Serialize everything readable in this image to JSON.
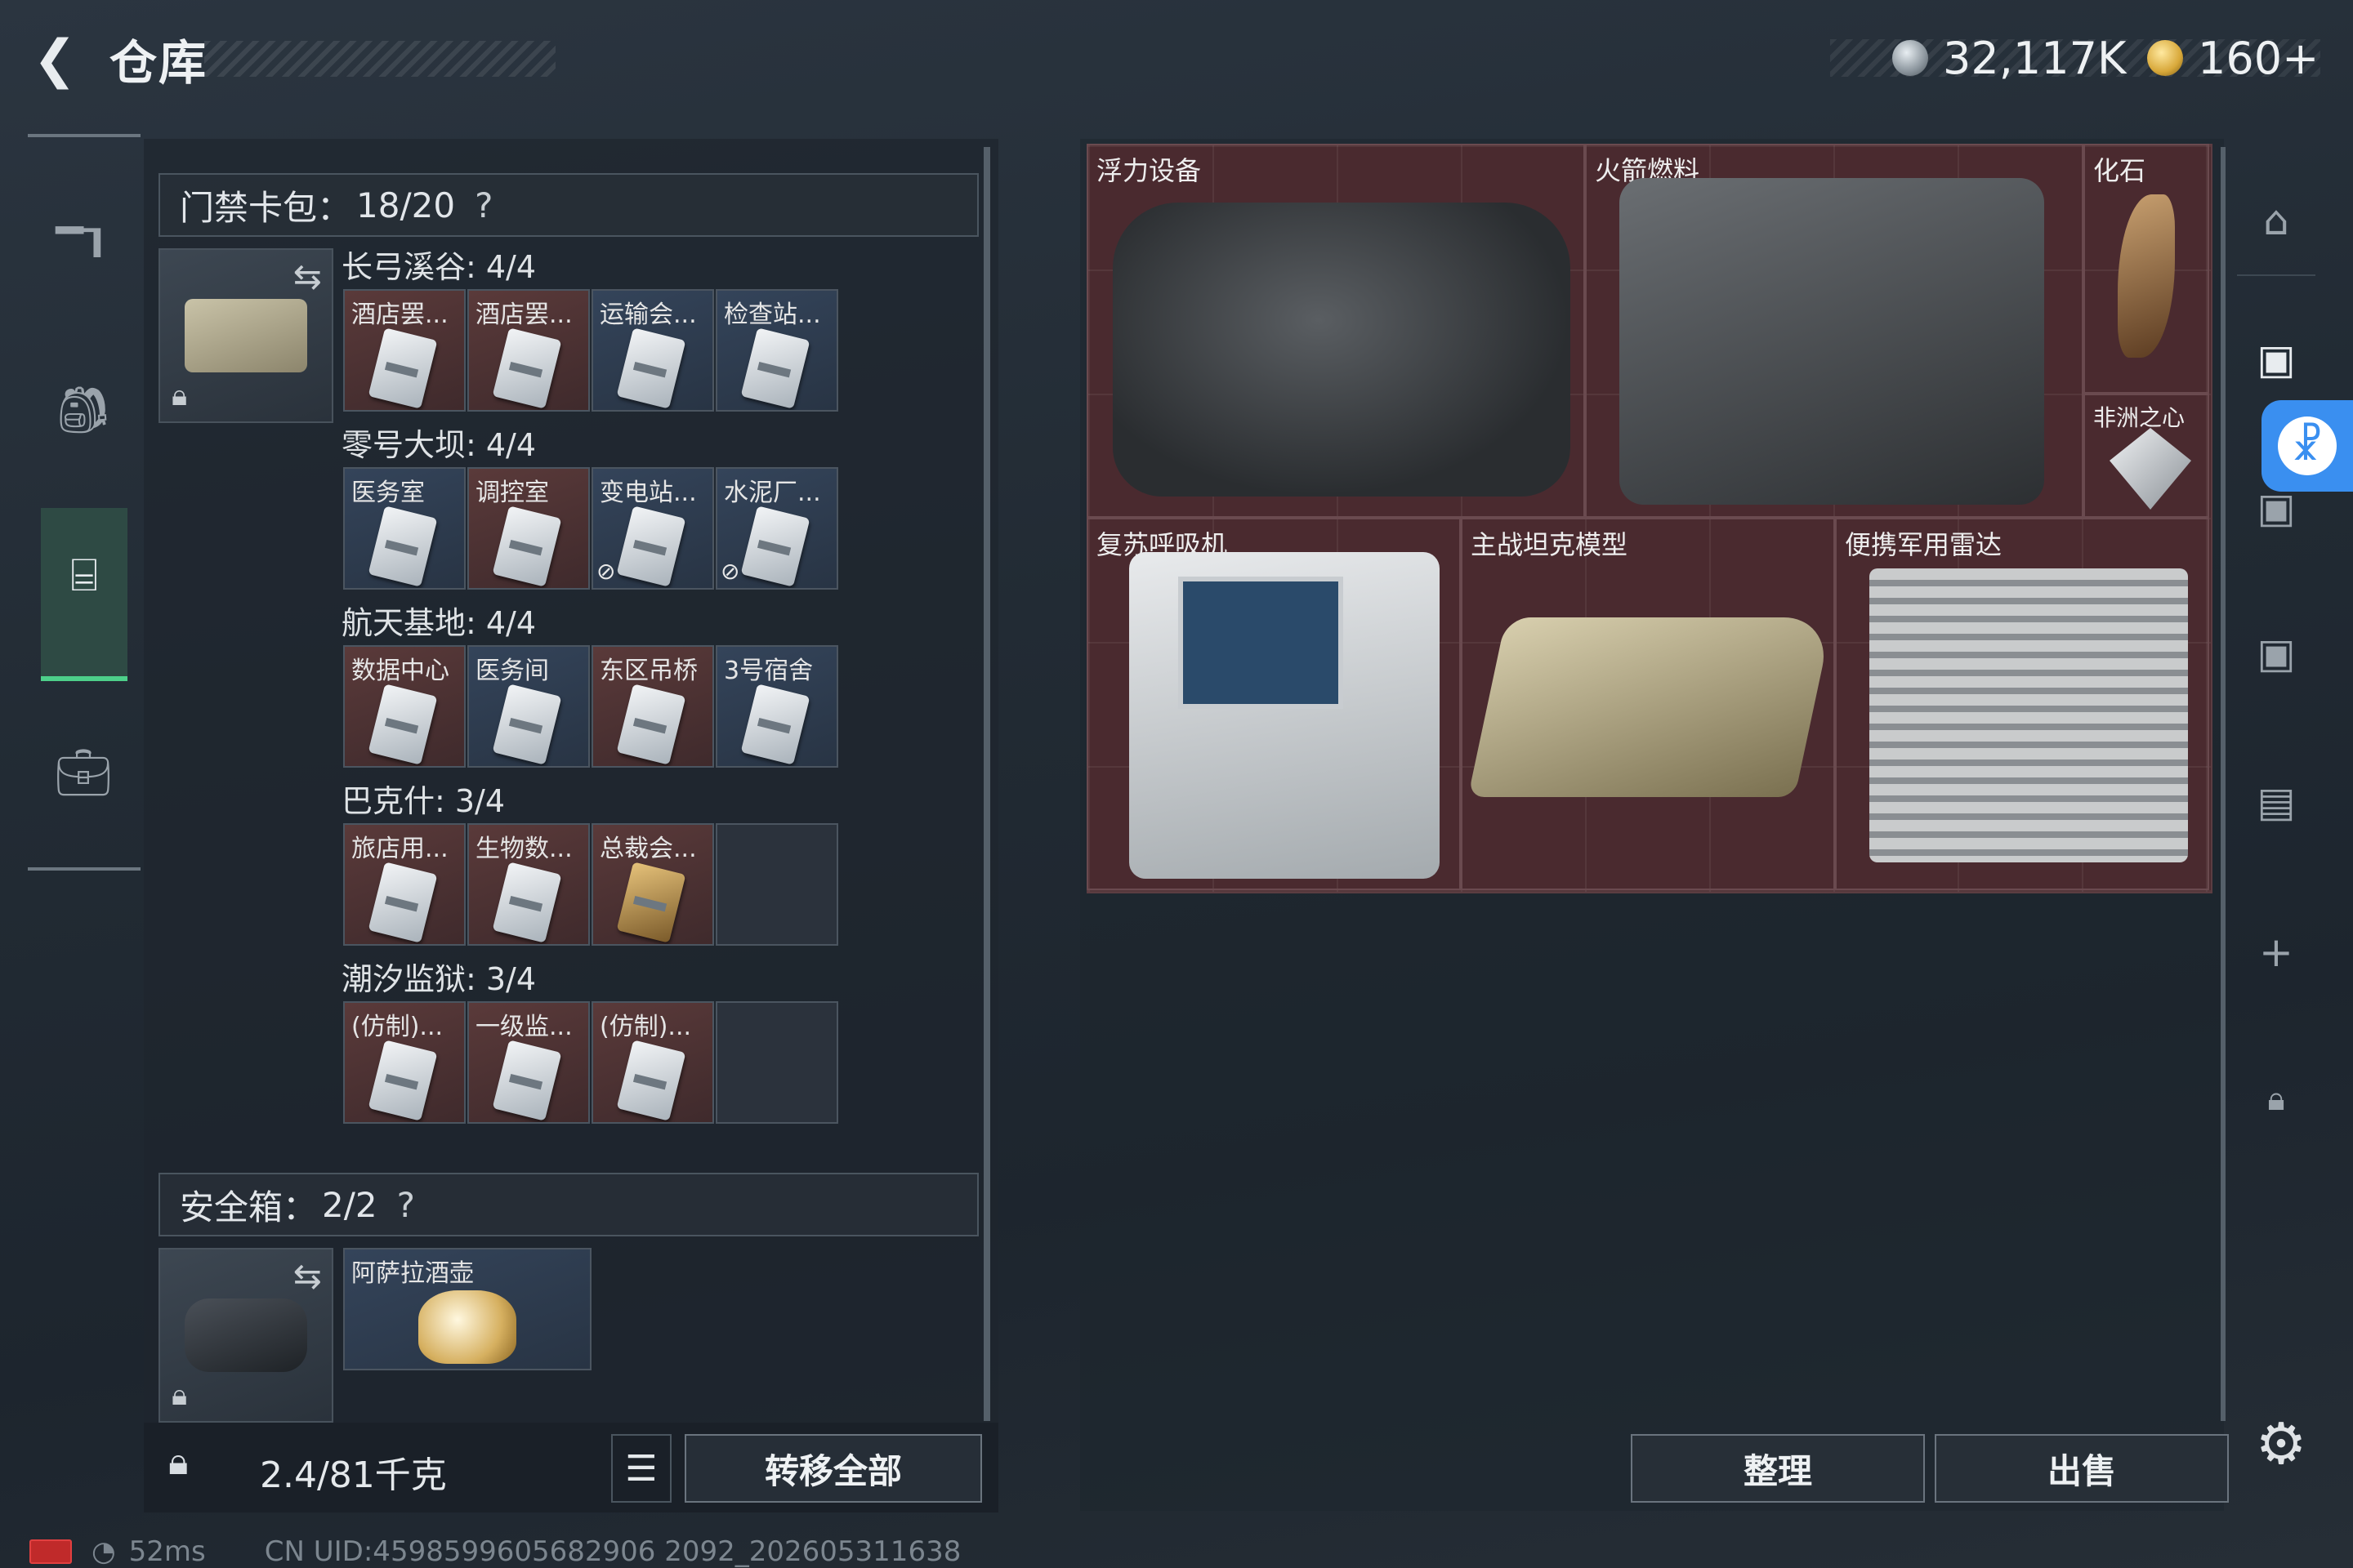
{
  "header": {
    "title": "仓库",
    "currency_1": "32,117K",
    "currency_2": "160+"
  },
  "left_nav": {
    "items": [
      {
        "name": "weapons",
        "icon": "rifle-icon"
      },
      {
        "name": "backpack",
        "icon": "backpack-icon"
      },
      {
        "name": "keycard-case",
        "icon": "card-case-icon",
        "selected": true
      },
      {
        "name": "toolbox",
        "icon": "toolbox-icon"
      }
    ]
  },
  "keycard_pack": {
    "label": "门禁卡包：",
    "count": "18/20",
    "help": "?",
    "groups": [
      {
        "title": "长弓溪谷: 4/4",
        "items": [
          "酒店罢...",
          "酒店罢...",
          "运输会...",
          "检查站..."
        ]
      },
      {
        "title": "零号大坝: 4/4",
        "items": [
          "医务室",
          "调控室",
          "变电站...",
          "水泥厂..."
        ]
      },
      {
        "title": "航天基地: 4/4",
        "items": [
          "数据中心",
          "医务间",
          "东区吊桥",
          "3号宿舍"
        ]
      },
      {
        "title": "巴克什: 3/4",
        "items": [
          "旅店用...",
          "生物数...",
          "总裁会...",
          ""
        ]
      },
      {
        "title": "潮汐监狱: 3/4",
        "items": [
          "(仿制)...",
          "一级监...",
          "(仿制)...",
          ""
        ]
      }
    ]
  },
  "safe_box": {
    "label": "安全箱：",
    "count": "2/2",
    "help": "?",
    "item": "阿萨拉酒壶"
  },
  "footer_left": {
    "weight": "2.4/81千克",
    "transfer_all": "转移全部"
  },
  "storage_items": [
    "浮力设备",
    "火箭燃料",
    "化石",
    "非洲之心",
    "复苏呼吸机",
    "主战坦克模型",
    "便携军用雷达"
  ],
  "footer_right": {
    "sort": "整理",
    "sell": "出售"
  },
  "status_bar": {
    "ping": "52ms",
    "uid": "CN UID:4598599605682906 2092_202605311638"
  },
  "colors": {
    "accent_green": "#4dd08a",
    "item_red_bg": "#4a2a2f",
    "accessibility_blue": "#3a8ff0"
  }
}
